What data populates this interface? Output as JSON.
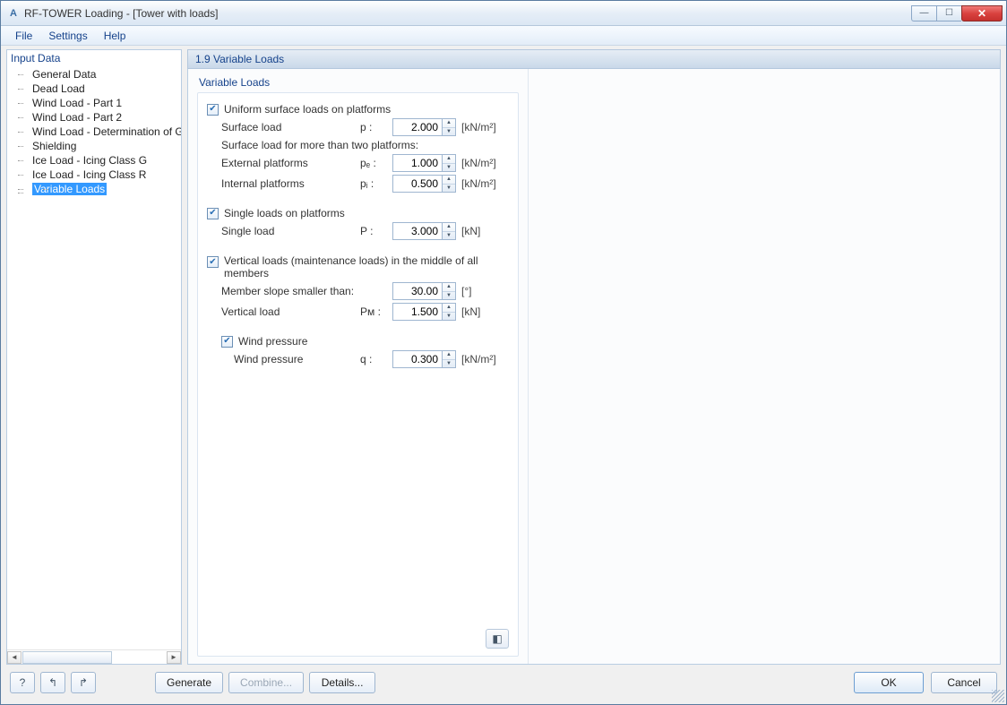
{
  "window": {
    "title": "RF-TOWER Loading - [Tower with loads]"
  },
  "menu": {
    "file": "File",
    "settings": "Settings",
    "help": "Help"
  },
  "tree": {
    "header": "Input Data",
    "items": [
      "General Data",
      "Dead Load",
      "Wind Load - Part 1",
      "Wind Load - Part 2",
      "Wind Load - Determination of Gust",
      "Shielding",
      "Ice Load - Icing Class G",
      "Ice Load - Icing Class R",
      "Variable Loads"
    ],
    "selected_index": 8
  },
  "content": {
    "header": "1.9 Variable Loads",
    "group": "Variable Loads",
    "uniform_chk": "Uniform surface loads on platforms",
    "surface_load": "Surface load",
    "surface_sym": "p :",
    "surface_val": "2.000",
    "surface_unit": "[kN/m²]",
    "more_two": "Surface load for more than two platforms:",
    "ext_plat": "External platforms",
    "ext_sym": "pₑ :",
    "ext_val": "1.000",
    "ext_unit": "[kN/m²]",
    "int_plat": "Internal platforms",
    "int_sym": "pᵢ :",
    "int_val": "0.500",
    "int_unit": "[kN/m²]",
    "single_chk": "Single loads on platforms",
    "single_load": "Single load",
    "single_sym": "P :",
    "single_val": "3.000",
    "single_unit": "[kN]",
    "vert_chk": "Vertical loads (maintenance loads) in the middle of all members",
    "slope": "Member slope smaller than:",
    "slope_val": "30.00",
    "slope_unit": "[°]",
    "vert_load": "Vertical load",
    "vert_sym": "Pᴍ :",
    "vert_val": "1.500",
    "vert_unit": "[kN]",
    "wind_chk": "Wind pressure",
    "wind_press": "Wind pressure",
    "wind_sym": "q :",
    "wind_val": "0.300",
    "wind_unit": "[kN/m²]"
  },
  "footer": {
    "generate": "Generate",
    "combine": "Combine...",
    "details": "Details...",
    "ok": "OK",
    "cancel": "Cancel"
  }
}
